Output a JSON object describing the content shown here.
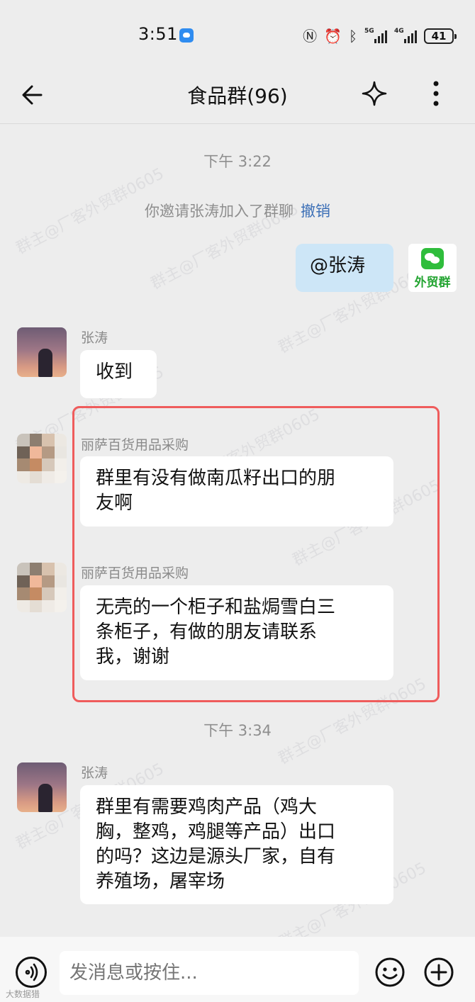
{
  "status_bar": {
    "time": "3:51",
    "battery": "41",
    "network_labels": [
      "5G",
      "4G"
    ]
  },
  "header": {
    "title": "食品群(96)"
  },
  "chat": {
    "time_1": "下午 3:22",
    "system_notice": "你邀请张涛加入了群聊",
    "undo_label": "撤销",
    "my_message": "@张涛",
    "my_avatar_text": "外贸群",
    "msg1": {
      "sender": "张涛",
      "text": "收到"
    },
    "msg2": {
      "sender": "丽萨百货用品采购",
      "text_line1": "群里有没有做南瓜籽出口的朋",
      "text_line2": "友啊"
    },
    "msg3": {
      "sender": "丽萨百货用品采购",
      "text_line1": "无壳的一个柜子和盐焗雪白三",
      "text_line2": "条柜子，有做的朋友请联系",
      "text_line3": "我，谢谢"
    },
    "time_2": "下午 3:34",
    "msg4": {
      "sender": "张涛",
      "text_line1": "群里有需要鸡肉产品（鸡大",
      "text_line2": "胸，整鸡，鸡腿等产品）出口",
      "text_line3": "的吗？这边是源头厂家，自有",
      "text_line4": "养殖场，屠宰场"
    }
  },
  "watermark_text": "群主@厂客外贸群0605",
  "input_bar": {
    "placeholder": "发消息或按住..."
  },
  "corner_text": "大数据猎",
  "colors": {
    "background": "#ededed",
    "my_bubble": "#cde6f7",
    "highlight": "#ef5c5c",
    "link": "#3c6fb6"
  }
}
